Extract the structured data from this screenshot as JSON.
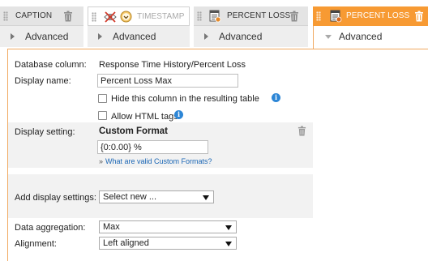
{
  "tabs": [
    {
      "title": "CAPTION",
      "sub_label": "Advanced"
    },
    {
      "title": "TIMESTAMP",
      "sub_label": "Advanced"
    },
    {
      "title": "PERCENT LOSS",
      "sub_label": "Advanced"
    },
    {
      "title": "PERCENT LOSS",
      "sub_label": "Advanced"
    }
  ],
  "form": {
    "database_column": {
      "label": "Database column:",
      "value": "Response Time History/Percent Loss"
    },
    "display_name": {
      "label": "Display name:",
      "value": "Percent Loss Max"
    },
    "hide_column": {
      "label": "Hide this column in the resulting table",
      "checked": false
    },
    "allow_html": {
      "label": "Allow HTML tags",
      "checked": false
    },
    "display_setting": {
      "label": "Display setting:",
      "heading": "Custom Format",
      "format_value": "{0:0.00} %",
      "help_link": "What are valid Custom Formats?"
    },
    "add_display_settings": {
      "label": "Add display settings:",
      "selected": "Select new ..."
    },
    "data_aggregation": {
      "label": "Data aggregation:",
      "selected": "Max"
    },
    "alignment": {
      "label": "Alignment:",
      "selected": "Left aligned"
    }
  },
  "colors": {
    "active_tab": "#f79a33",
    "info_icon": "#2d86d6",
    "link": "#1a66b5"
  },
  "icons": [
    "drag-grip-icon",
    "trash-icon",
    "hidden-eye-icon",
    "clock-icon",
    "table-settings-icon",
    "info-icon",
    "expand-arrow-icon",
    "dropdown-arrow-icon"
  ]
}
